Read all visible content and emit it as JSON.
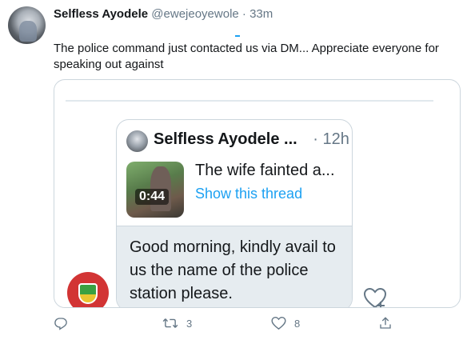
{
  "tweet": {
    "author_name": "Selfless Ayodele",
    "author_handle": "@ewejeoyewole",
    "separator": "·",
    "time": "33m",
    "text": "The police command just contacted us via DM... Appreciate everyone for speaking out against"
  },
  "quoted": {
    "author_name": "Selfless Ayodele ...",
    "separator": "·",
    "time": "12h",
    "video_duration": "0:44",
    "title": "The wife fainted a...",
    "thread_link": "Show this thread",
    "reply_text": "Good morning, kindly avail to us the name of the police station please."
  },
  "actions": {
    "reply_count": "",
    "retweet_count": "3",
    "like_count": "8"
  },
  "colors": {
    "accent": "#1da1f2",
    "muted": "#657786",
    "border": "#ccd6dd",
    "reply_bg": "#e6ecf0"
  },
  "icons": [
    "reply-icon",
    "retweet-icon",
    "like-icon",
    "share-icon",
    "heart-plus-icon"
  ]
}
